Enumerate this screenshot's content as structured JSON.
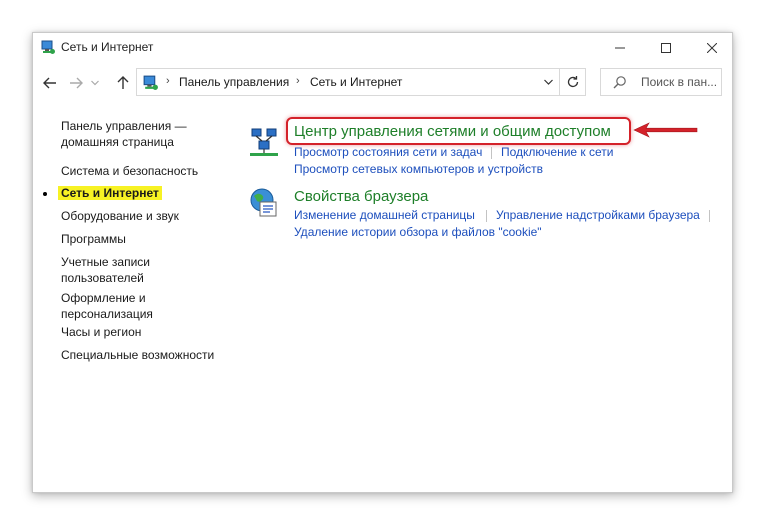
{
  "window": {
    "title": "Сеть и Интернет"
  },
  "address": {
    "segments": [
      "Панель управления",
      "Сеть и Интернет"
    ],
    "separator": "›"
  },
  "search": {
    "placeholder": "Поиск в пан..."
  },
  "sidebar": {
    "items": [
      {
        "label": "Панель управления —\nдомашняя страница",
        "line1": "Панель управления —",
        "line2": "домашняя страница"
      },
      {
        "label": "Система и безопасность"
      },
      {
        "label": "Сеть и Интернет",
        "active": true
      },
      {
        "label": "Оборудование и звук"
      },
      {
        "label": "Программы"
      },
      {
        "label": "Учетные записи пользователей",
        "line1": "Учетные записи",
        "line2": "пользователей"
      },
      {
        "label": "Оформление и персонализация",
        "line1": "Оформление и",
        "line2": "персонализация"
      },
      {
        "label": "Часы и регион"
      },
      {
        "label": "Специальные возможности"
      }
    ]
  },
  "main": {
    "categories": [
      {
        "title": "Центр управления сетями и общим доступом",
        "icon": "network-center-icon",
        "tasks": [
          "Просмотр состояния сети и задач",
          "Подключение к сети",
          "Просмотр сетевых компьютеров и устройств"
        ],
        "highlighted": true
      },
      {
        "title": "Свойства браузера",
        "icon": "browser-properties-icon",
        "tasks": [
          "Изменение домашней страницы",
          "Управление надстройками браузера",
          "Удаление истории обзора и файлов \"cookie\""
        ]
      }
    ]
  },
  "colors": {
    "category_title": "#1e7f29",
    "task_link": "#1d4fbd",
    "active_highlight": "#f7f224",
    "annotation_red": "#d4222a"
  }
}
